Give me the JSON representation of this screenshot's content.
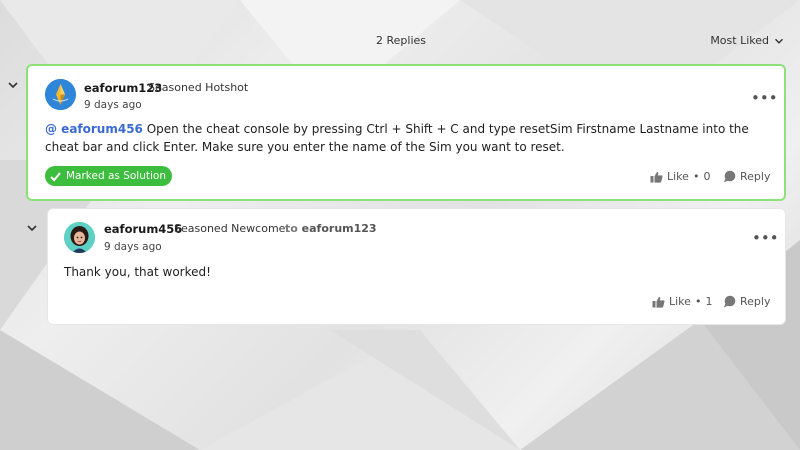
{
  "thread": {
    "replies_count": "2 Replies",
    "sort_label": "Most Liked"
  },
  "posts": [
    {
      "username": "eaforum123",
      "rank": "Seasoned Hotshot",
      "timestamp": "9 days ago",
      "mention": "@ eaforum456",
      "body": "Open the cheat console by pressing Ctrl + Shift + C and type resetSim Firstname Lastname into the cheat bar and click Enter. Make sure you enter the name of the Sim you want to reset.",
      "solution_label": "Marked as Solution",
      "like_label": "Like",
      "like_count": "0",
      "reply_label": "Reply",
      "more_label": "•••"
    },
    {
      "username": "eaforum456",
      "rank": "Seasoned Newcomer",
      "to_prefix": "to",
      "to_user": "eaforum123",
      "timestamp": "9 days ago",
      "body": "Thank you, that worked!",
      "like_label": "Like",
      "like_count": "1",
      "reply_label": "Reply",
      "more_label": "•••"
    }
  ],
  "colors": {
    "solution_green": "#3dbd3d",
    "solution_border": "#8ee07a",
    "mention_blue": "#3b6bd1"
  },
  "icons": [
    "chevron-down-icon",
    "check-icon",
    "thumbs-up-icon",
    "reply-bubble-icon",
    "more-options-icon"
  ]
}
